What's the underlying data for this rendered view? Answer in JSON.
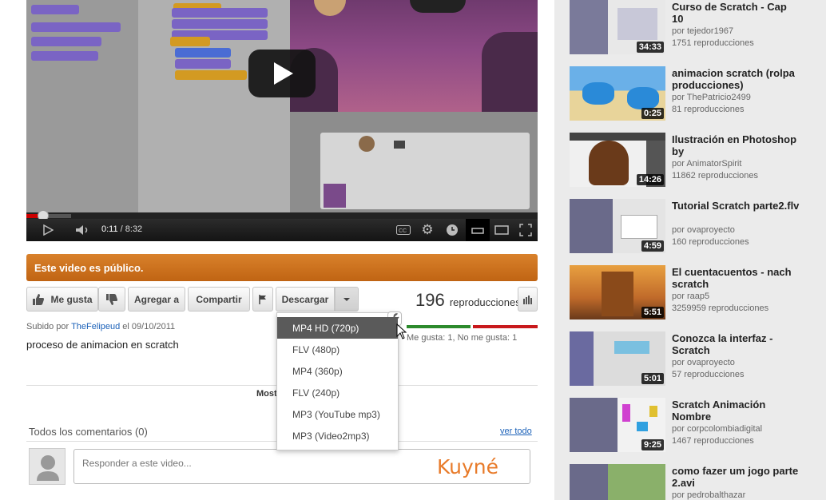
{
  "player": {
    "current_time": "0:11",
    "duration": "/ 8:32",
    "progress_fraction": 0.022,
    "icons": [
      "play-icon",
      "volume-icon",
      "cc-icon",
      "settings-gear-icon",
      "watch-later-icon",
      "small-player-icon",
      "large-player-icon",
      "fullscreen-icon"
    ]
  },
  "notice": {
    "text": "Este video es público."
  },
  "actions": {
    "like": "Me gusta",
    "add_to": "Agregar a",
    "share": "Compartir",
    "download": "Descargar"
  },
  "stats": {
    "views_count": "196",
    "views_label": "reproducciones",
    "likes_text": "Me gusta: 1, No me gusta: 1",
    "like_ratio": 0.5
  },
  "upload": {
    "prefix": "Subido por",
    "uploader": "TheFelipeud",
    "date": "el 09/10/2011",
    "description": "proceso de animacion en scratch"
  },
  "more": {
    "label": "Most"
  },
  "download_menu": {
    "items": [
      "MP4 HD (720p)",
      "FLV (480p)",
      "MP4 (360p)",
      "FLV (240p)",
      "MP3 (YouTube mp3)",
      "MP3 (Video2mp3)"
    ],
    "selected_index": 0
  },
  "comments": {
    "heading": "Todos los comentarios (0)",
    "see_all": "ver todo",
    "placeholder": "Responder a este video...",
    "watermark": "Kuyné"
  },
  "related": [
    {
      "title": "Curso de Scratch - Cap 10",
      "by": "por tejedor1967",
      "plays": "1751 reproducciones",
      "duration": "34:33"
    },
    {
      "title": "animacion scratch (rolpa producciones)",
      "by": "por ThePatricio2499",
      "plays": "81 reproducciones",
      "duration": "0:25"
    },
    {
      "title": "Ilustración en Photoshop by",
      "by": "por AnimatorSpirit",
      "plays": "11862 reproducciones",
      "duration": "14:26"
    },
    {
      "title": "Tutorial Scratch parte2.flv",
      "by": "por ovaproyecto",
      "plays": "160 reproducciones",
      "duration": "4:59"
    },
    {
      "title": "El cuentacuentos - nach scratch",
      "by": "por raap5",
      "plays": "3259959 reproducciones",
      "duration": "5:51"
    },
    {
      "title": "Conozca la interfaz - Scratch",
      "by": "por ovaproyecto",
      "plays": "57 reproducciones",
      "duration": "5:01"
    },
    {
      "title": "Scratch Animación Nombre",
      "by": "por corpcolombiadigital",
      "plays": "1467 reproducciones",
      "duration": "9:25"
    },
    {
      "title": "como fazer um jogo parte 2.avi",
      "by": "por pedrobalthazar",
      "plays": "",
      "duration": ""
    }
  ],
  "colors": {
    "notice_orange": "#c86a17",
    "link_blue": "#1c62b9",
    "like_green": "#2c8a2c",
    "dislike_red": "#c8191c",
    "progress_red": "#cc0000"
  }
}
